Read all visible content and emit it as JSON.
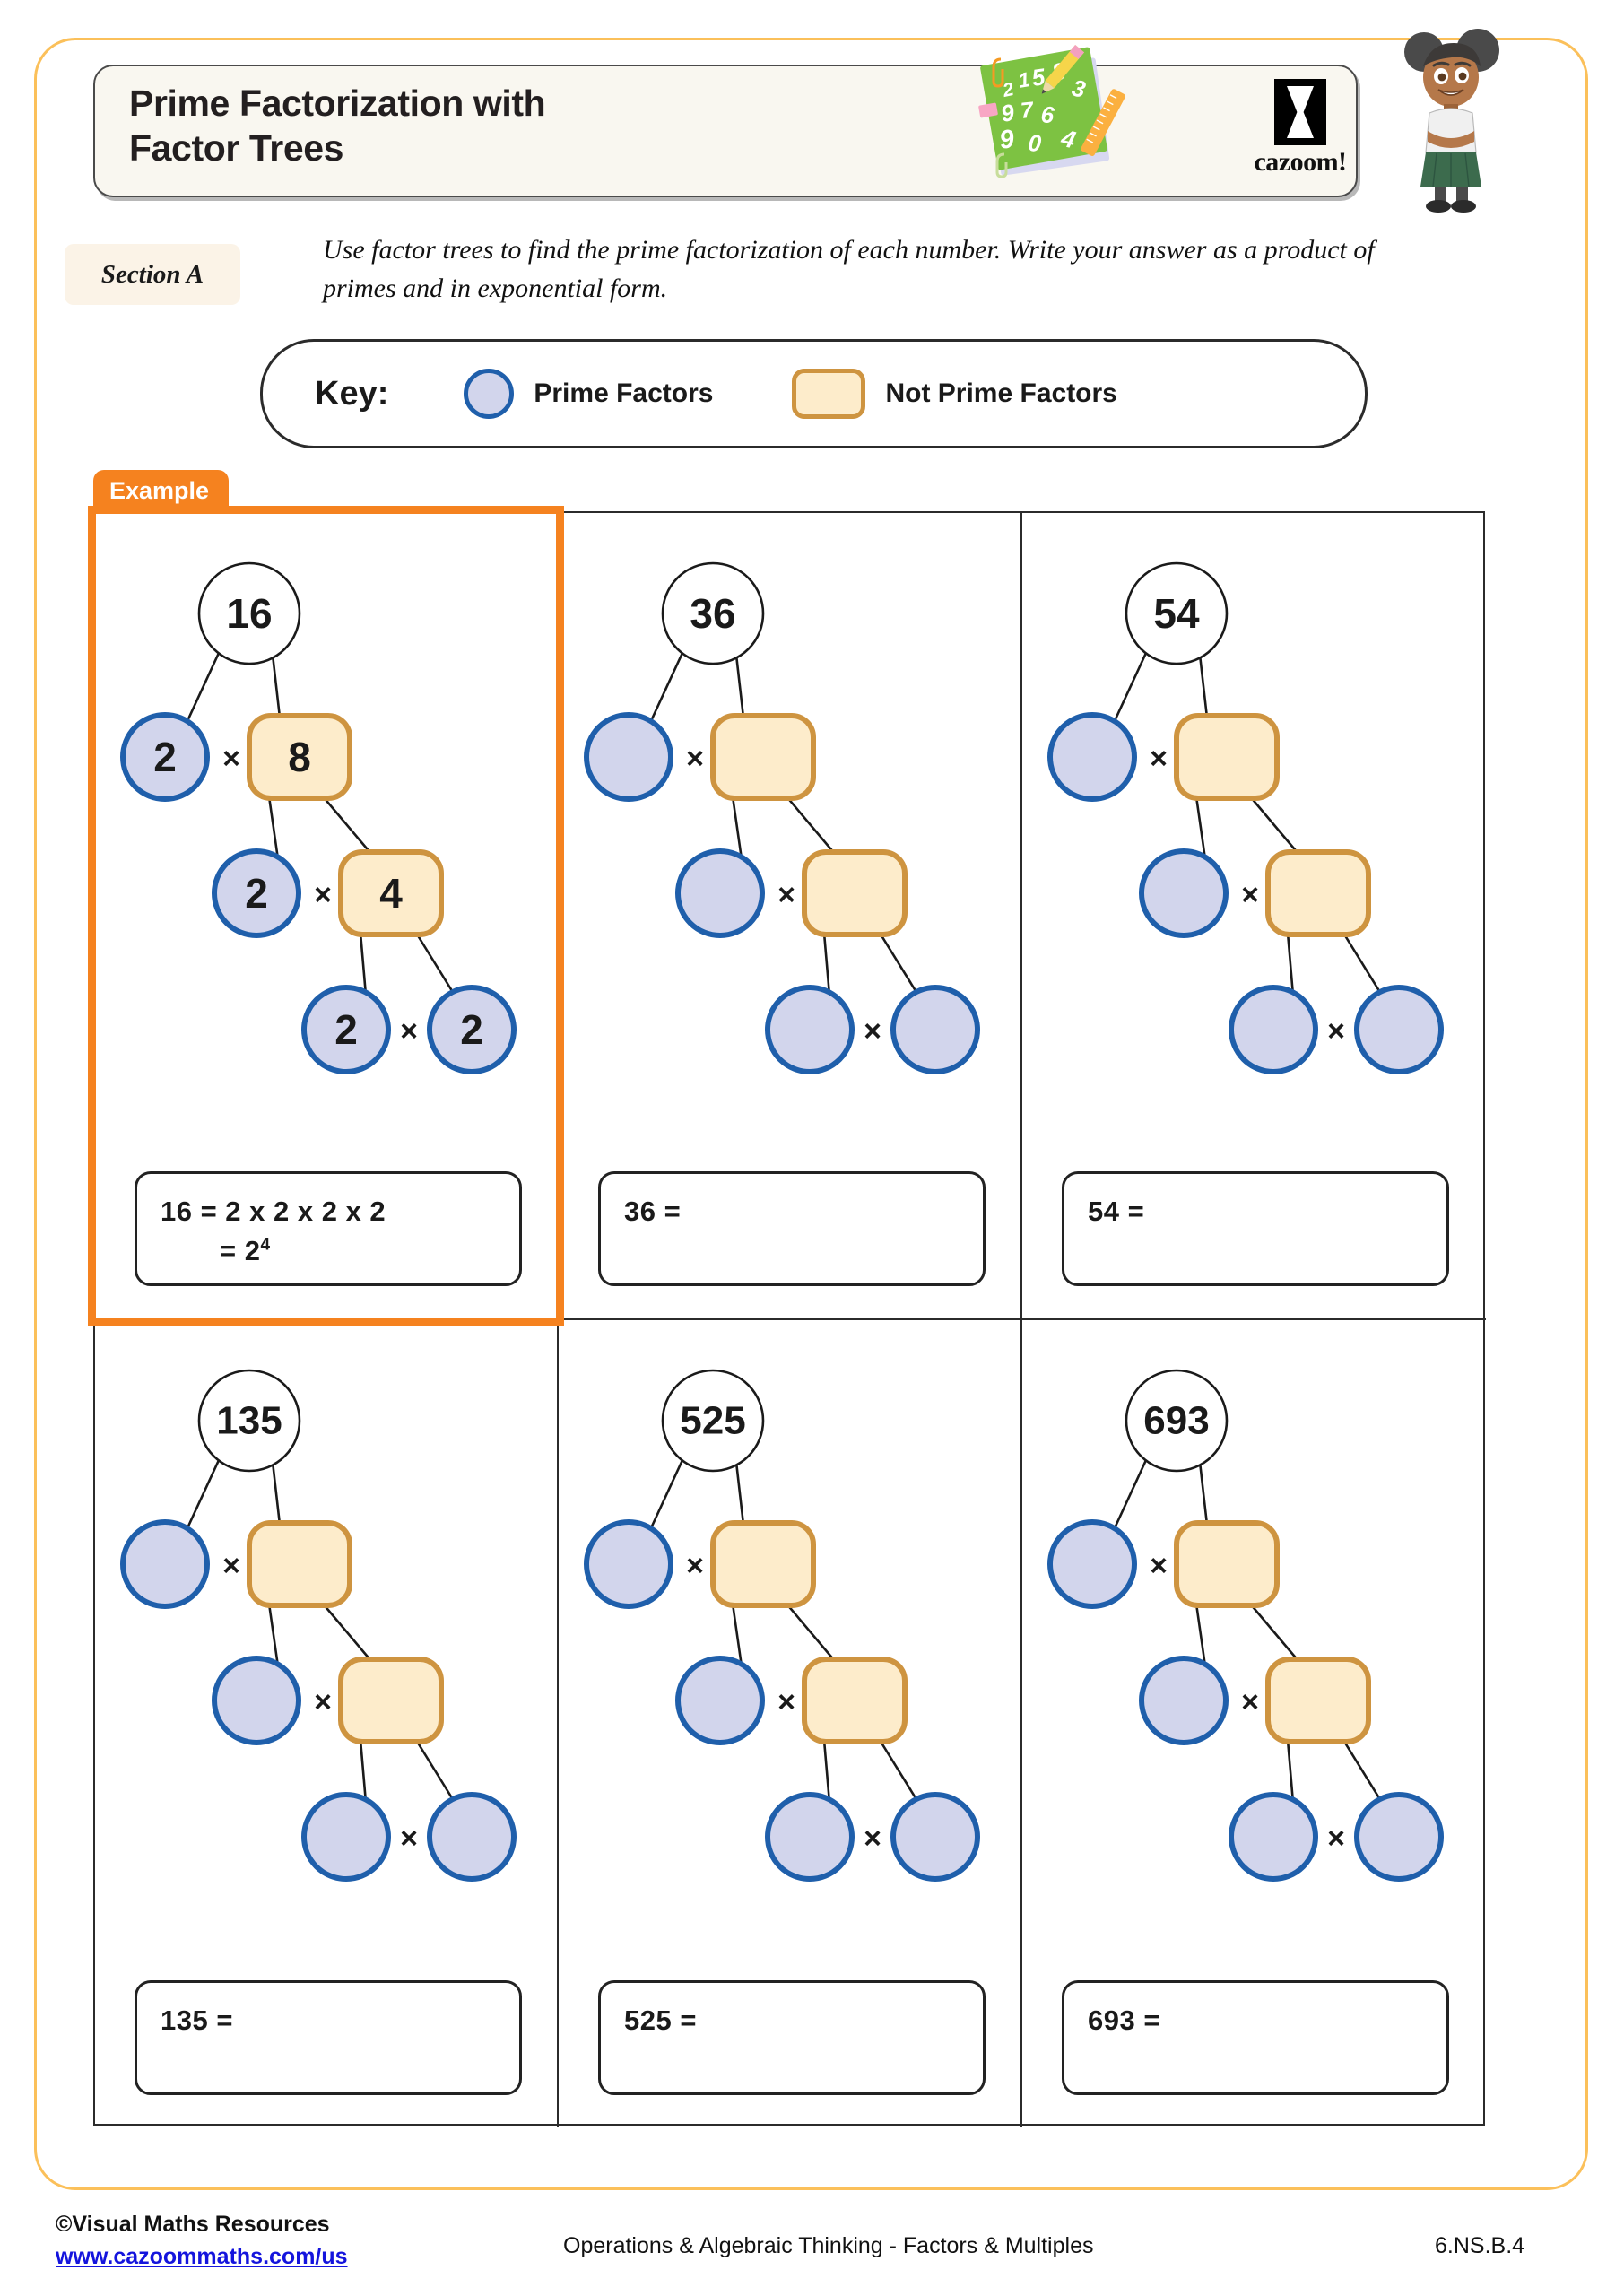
{
  "header": {
    "title_line1": "Prime Factorization with",
    "title_line2": "Factor Trees",
    "logo_word": "cazoom!",
    "doodle_numbers": [
      "2",
      "1",
      "5",
      "8",
      "3",
      "9",
      "7",
      "6",
      "4",
      "0"
    ]
  },
  "section": {
    "tag": "Section A",
    "instructions": "Use factor trees to find the prime factorization of each number.  Write your answer as a product of primes and in exponential form."
  },
  "key": {
    "label": "Key:",
    "prime_text": "Prime Factors",
    "not_prime_text": "Not Prime Factors"
  },
  "example_tab": "Example",
  "colors": {
    "frame": "#FBC05A",
    "example_orange": "#F5821F",
    "prime_fill": "#D2D5EC",
    "prime_stroke": "#1F5FAB",
    "composite_fill": "#FDECCB",
    "composite_stroke": "#CE9440",
    "link_blue": "#1414DD"
  },
  "multiply_symbol": "×",
  "problems": [
    {
      "id": "example-16",
      "is_example": true,
      "root": "16",
      "level1": {
        "prime": "2",
        "composite": "8"
      },
      "level2": {
        "prime": "2",
        "composite": "4"
      },
      "level3": {
        "prime_left": "2",
        "prime_right": "2"
      },
      "answer_line1": "16 = 2 x 2 x 2 x 2",
      "answer_line2_prefix": "= 2",
      "answer_line2_exp": "4"
    },
    {
      "id": "problem-36",
      "is_example": false,
      "root": "36",
      "level1": {
        "prime": "",
        "composite": ""
      },
      "level2": {
        "prime": "",
        "composite": ""
      },
      "level3": {
        "prime_left": "",
        "prime_right": ""
      },
      "answer_line1": "36 =",
      "answer_line2_prefix": "",
      "answer_line2_exp": ""
    },
    {
      "id": "problem-54",
      "is_example": false,
      "root": "54",
      "level1": {
        "prime": "",
        "composite": ""
      },
      "level2": {
        "prime": "",
        "composite": ""
      },
      "level3": {
        "prime_left": "",
        "prime_right": ""
      },
      "answer_line1": "54 =",
      "answer_line2_prefix": "",
      "answer_line2_exp": ""
    },
    {
      "id": "problem-135",
      "is_example": false,
      "root": "135",
      "level1": {
        "prime": "",
        "composite": ""
      },
      "level2": {
        "prime": "",
        "composite": ""
      },
      "level3": {
        "prime_left": "",
        "prime_right": ""
      },
      "answer_line1": "135 =",
      "answer_line2_prefix": "",
      "answer_line2_exp": ""
    },
    {
      "id": "problem-525",
      "is_example": false,
      "root": "525",
      "level1": {
        "prime": "",
        "composite": ""
      },
      "level2": {
        "prime": "",
        "composite": ""
      },
      "level3": {
        "prime_left": "",
        "prime_right": ""
      },
      "answer_line1": "525 =",
      "answer_line2_prefix": "",
      "answer_line2_exp": ""
    },
    {
      "id": "problem-693",
      "is_example": false,
      "root": "693",
      "level1": {
        "prime": "",
        "composite": ""
      },
      "level2": {
        "prime": "",
        "composite": ""
      },
      "level3": {
        "prime_left": "",
        "prime_right": ""
      },
      "answer_line1": "693 =",
      "answer_line2_prefix": "",
      "answer_line2_exp": ""
    }
  ],
  "footer": {
    "copyright": "©Visual Maths Resources",
    "website": "www.cazoommaths.com/us",
    "center": "Operations & Algebraic Thinking - Factors & Multiples",
    "standard": "6.NS.B.4"
  }
}
